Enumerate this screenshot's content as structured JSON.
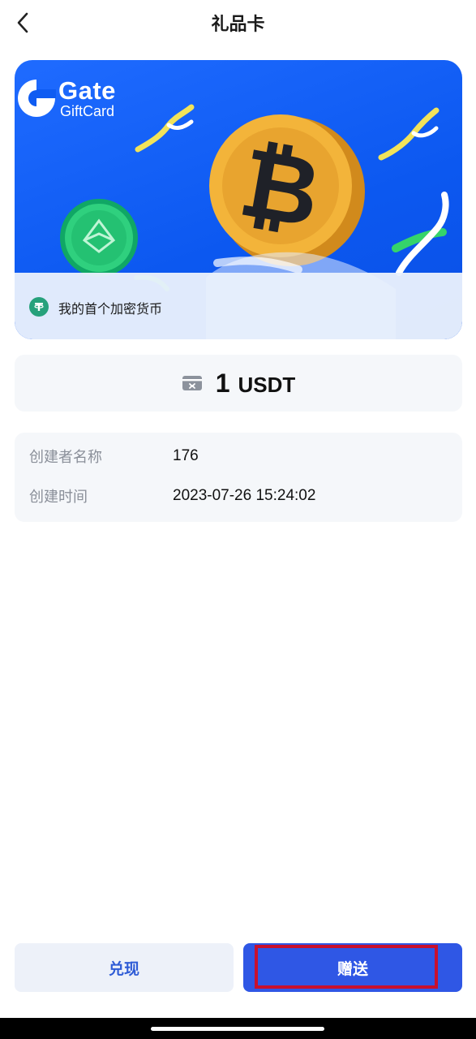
{
  "header": {
    "title": "礼品卡",
    "back_icon": "chevron-left-icon"
  },
  "card": {
    "brand": "Gate",
    "brand_sub": "GiftCard",
    "message": "我的首个加密货币",
    "message_icon": "tether-icon",
    "colors": {
      "background": "#1464ff",
      "caption_bg": "#e9f0fc"
    }
  },
  "amount": {
    "value": "1",
    "unit": "USDT",
    "icon": "gift-card-icon"
  },
  "info": {
    "rows": [
      {
        "label": "创建者名称",
        "value": "176"
      },
      {
        "label": "创建时间",
        "value": "2023-07-26 15:24:02"
      }
    ]
  },
  "actions": {
    "redeem_label": "兑现",
    "send_label": "赠送",
    "accent": "#2f57e5",
    "highlight_color": "#c8102e"
  }
}
